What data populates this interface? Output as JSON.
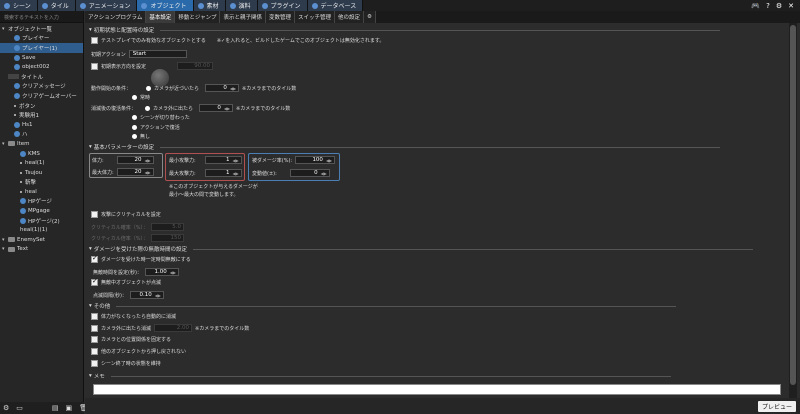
{
  "top_tabs": [
    {
      "label": "シーン",
      "active": false
    },
    {
      "label": "タイル",
      "active": false
    },
    {
      "label": "アニメーション",
      "active": false
    },
    {
      "label": "オブジェクト",
      "active": true
    },
    {
      "label": "素材",
      "active": false
    },
    {
      "label": "演料",
      "active": false
    },
    {
      "label": "プラグイン",
      "active": false
    },
    {
      "label": "データベース",
      "active": false
    }
  ],
  "top_right_icons": [
    "game-icon",
    "help-icon",
    "gear-icon",
    "close-icon"
  ],
  "search": {
    "placeholder": "検索するテキストを入力"
  },
  "tree": [
    {
      "label": "オブジェクト一覧",
      "depth": 0,
      "icon": "arrow",
      "selected": false
    },
    {
      "label": "プレイヤー",
      "depth": 1,
      "icon": "object",
      "selected": false
    },
    {
      "label": "プレイヤー(1)",
      "depth": 1,
      "icon": "object",
      "selected": true
    },
    {
      "label": "Save",
      "depth": 1,
      "icon": "object",
      "selected": false
    },
    {
      "label": "object002",
      "depth": 1,
      "icon": "object",
      "selected": false
    },
    {
      "label": "タイトル",
      "depth": 0,
      "icon": "hud",
      "selected": false
    },
    {
      "label": "クリアメッセージ",
      "depth": 1,
      "icon": "object",
      "selected": false
    },
    {
      "label": "クリアゲームオーバー",
      "depth": 1,
      "icon": "object",
      "selected": false
    },
    {
      "label": "ボタン",
      "depth": 1,
      "icon": "dot",
      "selected": false
    },
    {
      "label": "実験用1",
      "depth": 1,
      "icon": "dot",
      "selected": false
    },
    {
      "label": "Hs1",
      "depth": 1,
      "icon": "object",
      "selected": false
    },
    {
      "label": "ハ",
      "depth": 1,
      "icon": "object",
      "selected": false
    },
    {
      "label": "Item",
      "depth": 0,
      "icon": "folder",
      "selected": false
    },
    {
      "label": "KMS",
      "depth": 2,
      "icon": "object",
      "selected": false
    },
    {
      "label": "heal(1)",
      "depth": 2,
      "icon": "dot",
      "selected": false
    },
    {
      "label": "Tsujou",
      "depth": 2,
      "icon": "dot",
      "selected": false
    },
    {
      "label": "斬撃",
      "depth": 2,
      "icon": "dot",
      "selected": false
    },
    {
      "label": "heal",
      "depth": 2,
      "icon": "dot",
      "selected": false
    },
    {
      "label": "HPゲージ",
      "depth": 2,
      "icon": "object",
      "selected": false
    },
    {
      "label": "MPgage",
      "depth": 2,
      "icon": "object",
      "selected": false
    },
    {
      "label": "HPゲージ(2)",
      "depth": 2,
      "icon": "object",
      "selected": false
    },
    {
      "label": "heal(1)(1)",
      "depth": 2,
      "icon": "none",
      "selected": false
    },
    {
      "label": "EnemySet",
      "depth": 0,
      "icon": "folder",
      "selected": false
    },
    {
      "label": "Text",
      "depth": 0,
      "icon": "folder",
      "selected": false
    }
  ],
  "sub_tabs": [
    {
      "label": "アクションプログラム",
      "active": false
    },
    {
      "label": "基本設定",
      "active": true
    },
    {
      "label": "移動とジャンプ",
      "active": false
    },
    {
      "label": "表示と親子関係",
      "active": false
    },
    {
      "label": "変数管理",
      "active": false
    },
    {
      "label": "スイッチ管理",
      "active": false
    },
    {
      "label": "他の設定",
      "active": false
    }
  ],
  "init": {
    "section": "初期状態と配置時の設定",
    "test_only": "テストプレイでのみ有効なオブジェクトとする",
    "test_note": "※✓を入れると、ビルドしたゲームでこのオブジェクトは無効化されます。",
    "init_action_label": "初期アクション",
    "init_action_value": "Start",
    "init_dir_label": "初期表示方向を設定",
    "init_dir_value": "90.00",
    "start_label": "動作開始の条件：",
    "start_opt1": "カメラが近づいたら",
    "start_val": "0",
    "start_unit": "※カメラまでのタイル数",
    "start_opt2": "常時",
    "revive_label": "消滅後の復活条件：",
    "revive_opt1": "カメラ外に出たら",
    "revive_val": "0",
    "revive_unit": "※カメラまでのタイル数",
    "revive_opt2": "シーンが切り替わった",
    "revive_opt3": "アクションで復活",
    "revive_opt4": "無し"
  },
  "params": {
    "section": "基本パラメーターの設定",
    "hp_label": "体力:",
    "hp": "20",
    "maxhp_label": "最大体力:",
    "maxhp": "20",
    "minatk_label": "最小攻撃力:",
    "minatk": "1",
    "maxatk_label": "最大攻撃力:",
    "maxatk": "1",
    "dmgrate_label": "被ダメージ率(%):",
    "dmgrate": "100",
    "variance_label": "変動値(±):",
    "variance": "0",
    "note": "※このオブジェクトが与えるダメージが最小〜最大の間で変動します。",
    "critical": "攻撃にクリティカルを設定",
    "crit_rate_label": "クリティカル確率（%）：",
    "crit_rate": "5.0",
    "crit_mult_label": "クリティカル倍率（%）：",
    "crit_mult": "150"
  },
  "invincible": {
    "section": "ダメージを受けた際の無敵時間の設定",
    "enable": "ダメージを受けた時一定時間無敵にする",
    "time_label": "無敵時間を設定(秒)：",
    "time": "1.00",
    "blink": "無敵中オブジェクトが点滅",
    "interval_label": "点滅間隔(秒)：",
    "interval": "0.10"
  },
  "other": {
    "section": "その他",
    "opt1": "体力がなくなったら自動的に消滅",
    "opt2": "カメラ外に出たら消滅",
    "opt2_val": "2.00",
    "opt2_unit": "※カメラまでのタイル数",
    "opt3": "カメラとの位置関係を固定する",
    "opt4": "他のオブジェクトから押し戻されない",
    "opt5": "シーン終了時の状態を維持"
  },
  "memo": {
    "section": "メモ",
    "value": ""
  },
  "preview_label": "プレビュー",
  "left_bottom_icons": [
    "gear-icon",
    "folder-icon",
    "add-folder-icon",
    "add-object-icon",
    "delete-icon"
  ]
}
